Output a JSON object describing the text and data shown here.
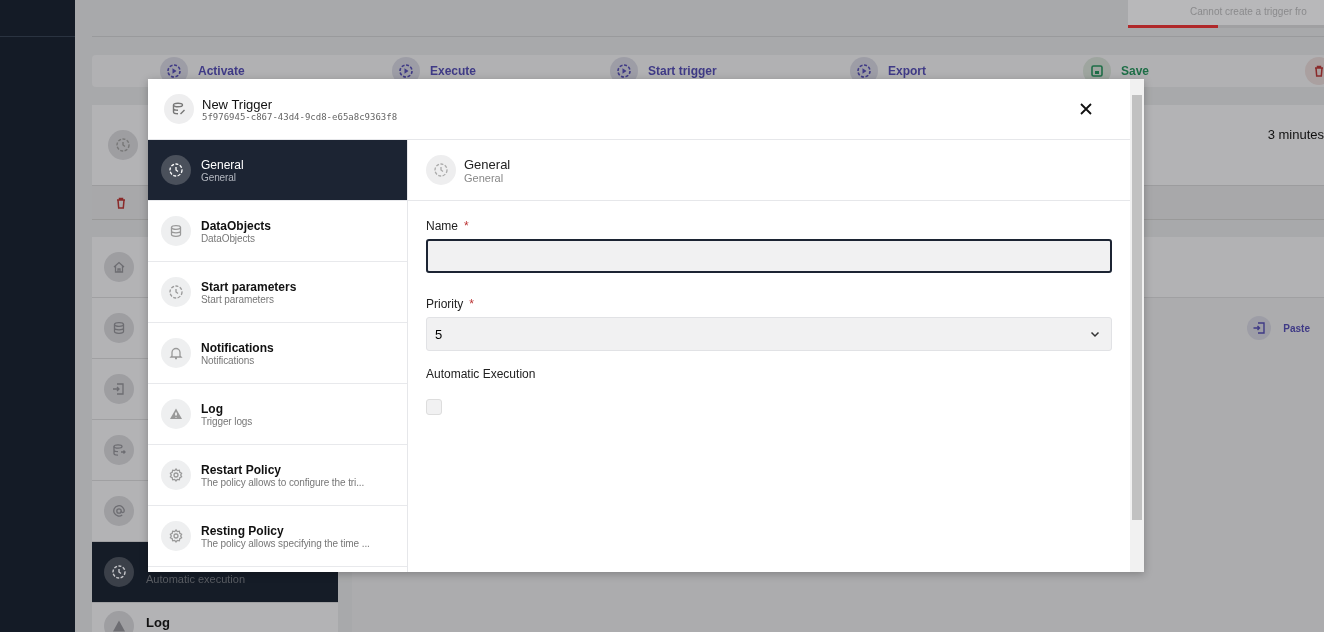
{
  "toast": {
    "message": "Cannot create a trigger fro",
    "level": 0.46
  },
  "toolbar": {
    "buttons": [
      {
        "kind": "action",
        "label": "Activate"
      },
      {
        "kind": "action",
        "label": "Execute"
      },
      {
        "kind": "action",
        "label": "Start trigger"
      },
      {
        "kind": "action",
        "label": "Export"
      },
      {
        "kind": "save",
        "label": "Save"
      },
      {
        "kind": "delete"
      }
    ]
  },
  "record": {
    "time": "3 minutes"
  },
  "side_list": {
    "items": [
      {
        "subtitle": "Automatic execution",
        "selected": true
      },
      {
        "title": "Log",
        "selected": false
      }
    ]
  },
  "paste_button": {
    "label": "Paste"
  },
  "modal": {
    "title": "New Trigger",
    "id": "5f976945-c867-43d4-9cd8-e65a8c9363f8",
    "nav": [
      {
        "title": "General",
        "subtitle": "General",
        "selected": true
      },
      {
        "title": "DataObjects",
        "subtitle": "DataObjects",
        "selected": false
      },
      {
        "title": "Start parameters",
        "subtitle": "Start parameters",
        "selected": false
      },
      {
        "title": "Notifications",
        "subtitle": "Notifications",
        "selected": false
      },
      {
        "title": "Log",
        "subtitle": "Trigger logs",
        "selected": false
      },
      {
        "title": "Restart Policy",
        "subtitle": "The policy allows to configure the tri...",
        "selected": false
      },
      {
        "title": "Resting Policy",
        "subtitle": "The policy allows specifying the time ...",
        "selected": false
      }
    ],
    "section": {
      "title": "General",
      "subtitle": "General"
    },
    "name_field": {
      "label": "Name",
      "required_mark": "*"
    },
    "priority_field": {
      "label": "Priority",
      "required_mark": "*",
      "value": "5"
    },
    "auto_execution": {
      "label": "Automatic Execution",
      "checked": false
    }
  }
}
